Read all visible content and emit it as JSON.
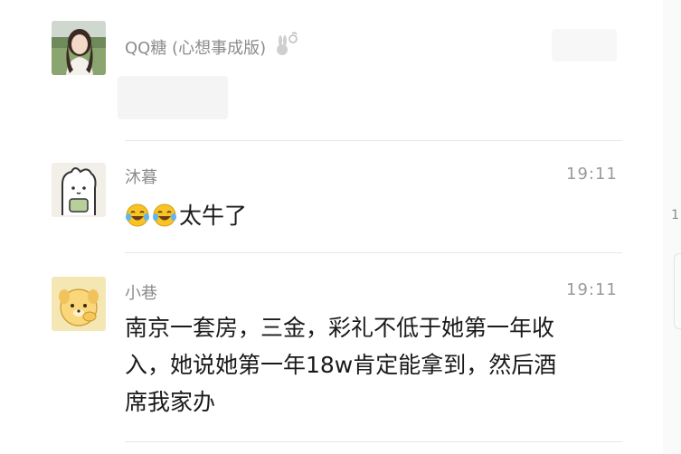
{
  "messages": [
    {
      "sender": "QQ糖 (心想事成版)",
      "sender_icon": "rabbit-icon",
      "time": "",
      "text": ""
    },
    {
      "sender": "沐暮",
      "time": "19:11",
      "emoji": [
        "laughing-crying-emoji",
        "laughing-crying-emoji"
      ],
      "text": "太牛了"
    },
    {
      "sender": "小巷",
      "time": "19:11",
      "text_lines": [
        "南京一套房，三金，彩礼不低于她第一年收",
        "入，她说她第一年18w肯定能拿到，然后酒",
        "席我家办"
      ]
    }
  ],
  "edge": {
    "glyph": "1"
  },
  "colors": {
    "name": "#8c8c8c",
    "time": "#9a9a9a",
    "text": "#1a1a1a",
    "divider": "#e6e6e6"
  }
}
